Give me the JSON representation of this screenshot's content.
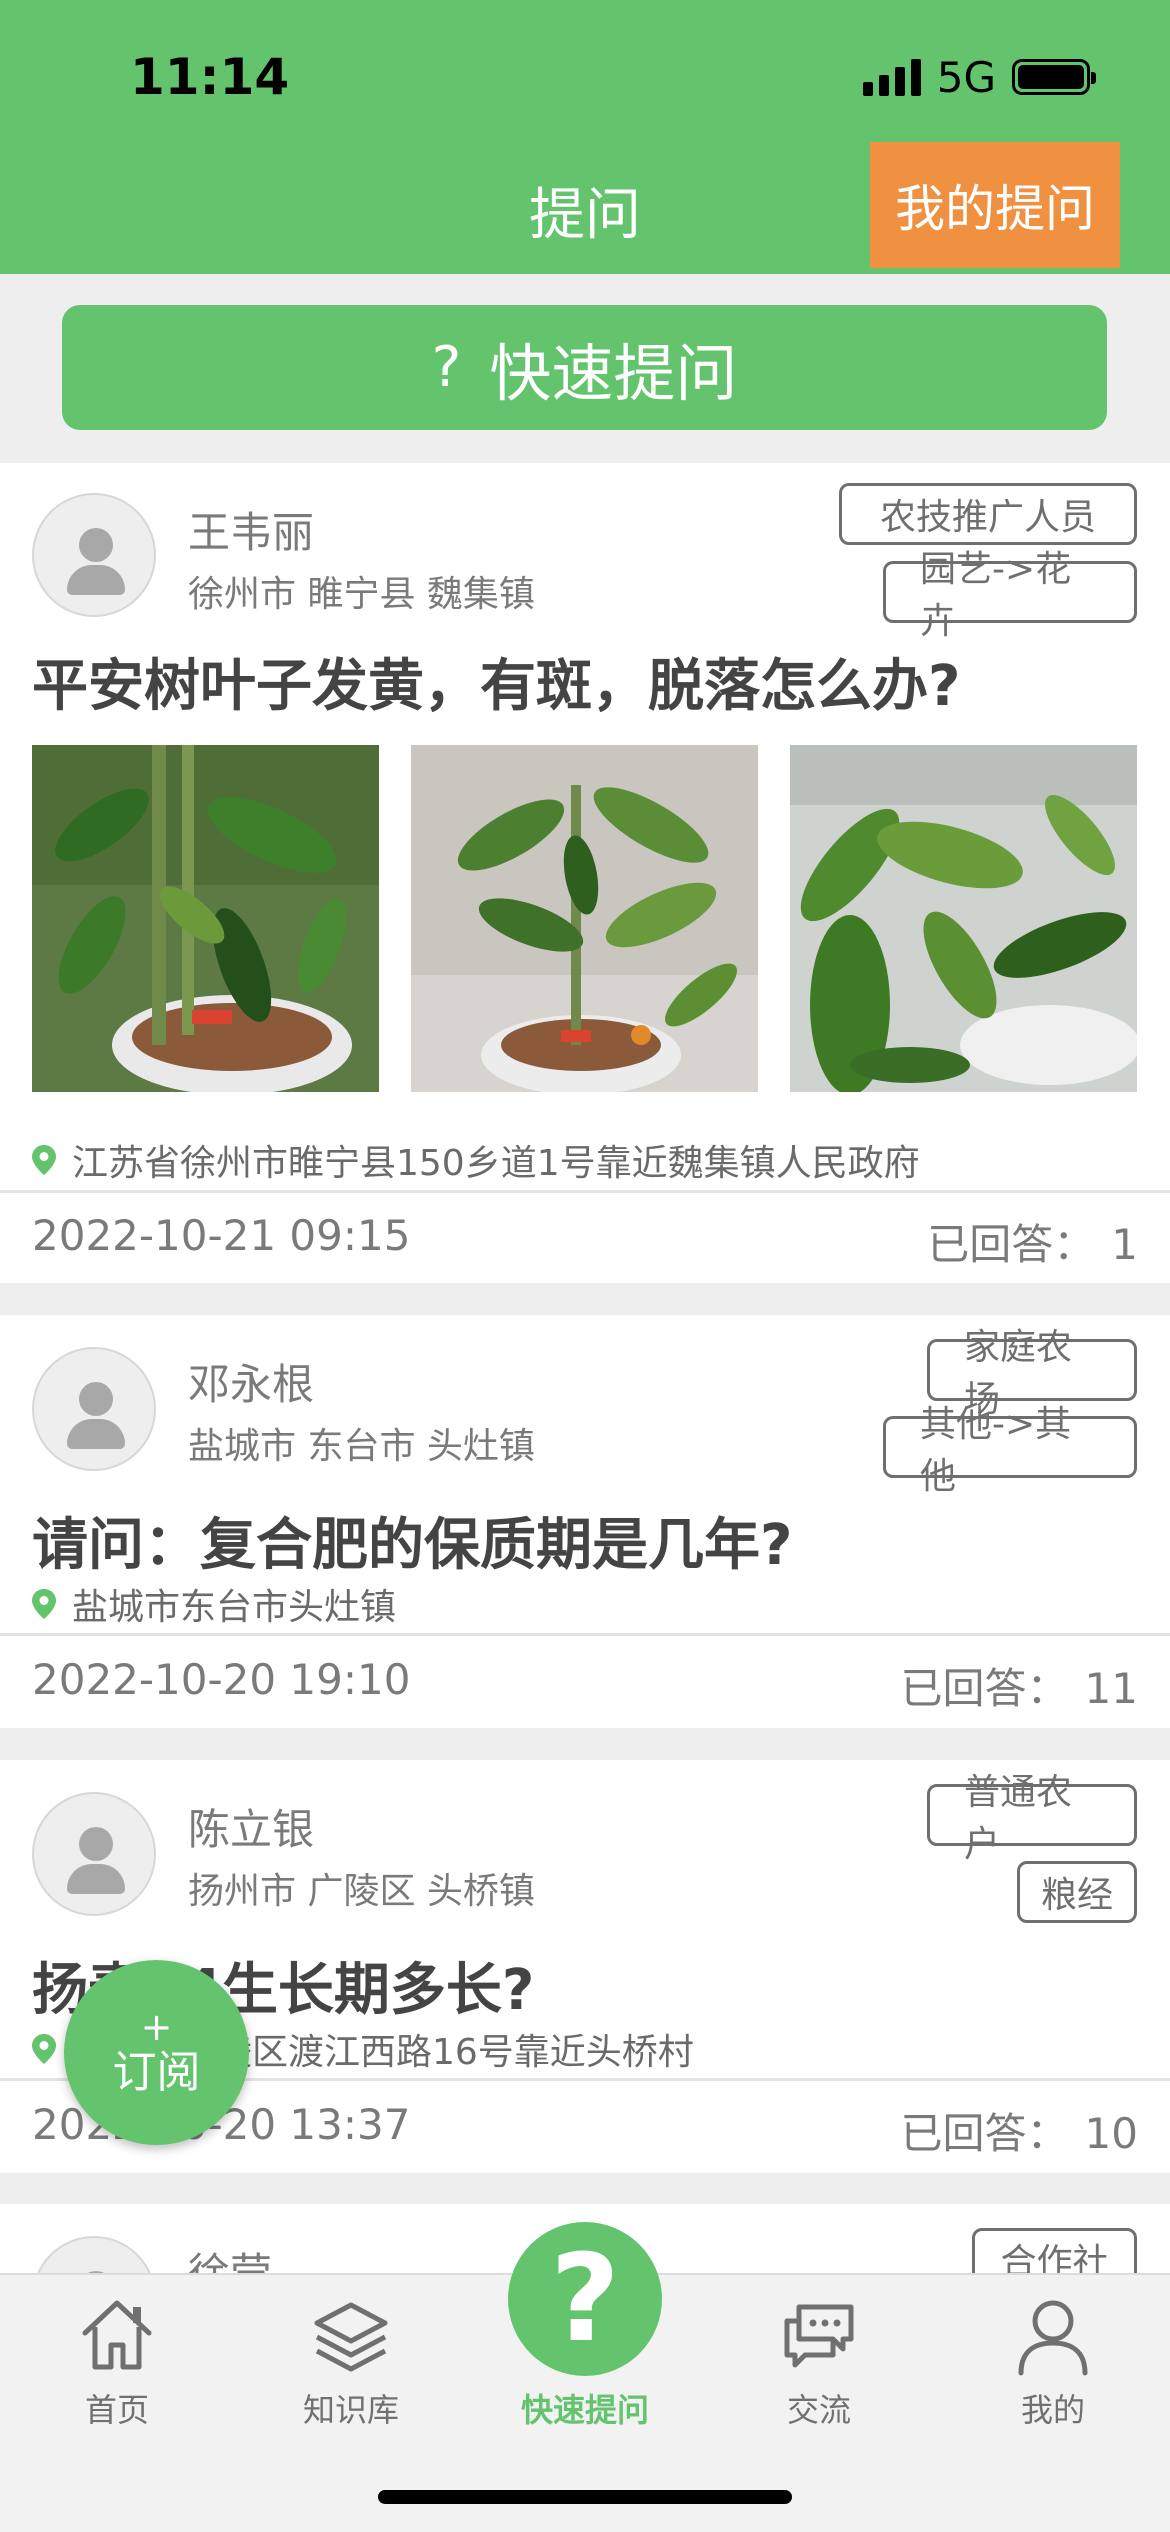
{
  "status": {
    "time": "11:14",
    "network": "5G"
  },
  "nav": {
    "title": "提问",
    "my_questions": "我的提问"
  },
  "quick_ask": {
    "icon": "?",
    "label": "快速提问"
  },
  "posts": [
    {
      "name": "王韦丽",
      "location": "徐州市 睢宁县 魏集镇",
      "tags": [
        "农技推广人员",
        "园艺->花卉"
      ],
      "title": "平安树叶子发黄，有斑，脱落怎么办?",
      "address": "江苏省徐州市睢宁县150乡道1号靠近魏集镇人民政府",
      "date": "2022-10-21 09:15",
      "answered_label": "已回答：",
      "answered_count": "1"
    },
    {
      "name": "邓永根",
      "location": "盐城市 东台市 头灶镇",
      "tags": [
        "家庭农场",
        "其他->其他"
      ],
      "title": "请问：复合肥的保质期是几年?",
      "address": "盐城市东台市头灶镇",
      "date": "2022-10-20 19:10",
      "answered_label": "已回答：",
      "answered_count": "11"
    },
    {
      "name": "陈立银",
      "location": "扬州市 广陵区 头桥镇",
      "tags": [
        "普通农户",
        "粮经"
      ],
      "title": "扬麦24生长期多长?",
      "address": "扬州市广陵区渡江西路16号靠近头桥村",
      "date": "2022-10-20 13:37",
      "answered_label": "已回答：",
      "answered_count": "10"
    },
    {
      "name": "徐莹",
      "tags": [
        "合作社"
      ]
    }
  ],
  "fab": {
    "plus": "+",
    "label": "订阅"
  },
  "tabs": [
    {
      "label": "首页",
      "icon": "home-icon"
    },
    {
      "label": "知识库",
      "icon": "layers-icon"
    },
    {
      "label": "快速提问",
      "icon": "question-icon"
    },
    {
      "label": "交流",
      "icon": "chat-icon"
    },
    {
      "label": "我的",
      "icon": "user-icon"
    }
  ],
  "colors": {
    "primary": "#63c46d",
    "accent": "#ef9141"
  }
}
